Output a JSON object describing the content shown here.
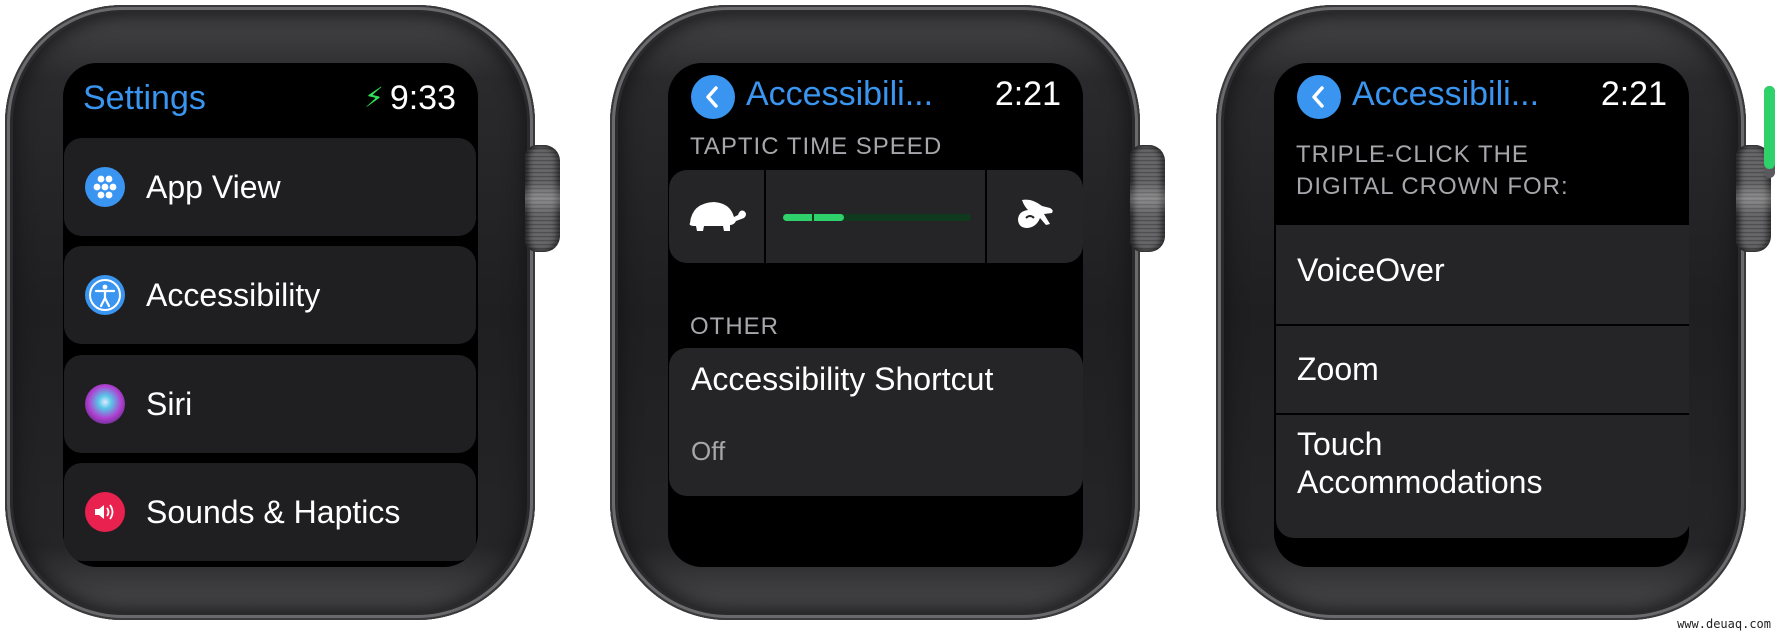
{
  "colors": {
    "accent_blue": "#3a95f0",
    "green": "#2ed16a",
    "card": "#1f1f21",
    "secondary_text": "#a6a6ab"
  },
  "watch1": {
    "title": "Settings",
    "charging_icon": "bolt-icon",
    "time": "9:33",
    "items": [
      {
        "label": "App View",
        "icon": "app-view-grid-icon",
        "icon_color": "#3a95f0"
      },
      {
        "label": "Accessibility",
        "icon": "accessibility-icon",
        "icon_color": "#3a95f0"
      },
      {
        "label": "Siri",
        "icon": "siri-icon",
        "icon_color": "#7a3bd0"
      },
      {
        "label": "Sounds & Haptics",
        "icon": "speaker-icon",
        "icon_color": "#e8214f"
      }
    ]
  },
  "watch2": {
    "back_icon": "chevron-left-icon",
    "title": "Accessibili...",
    "time": "2:21",
    "section1": "TAPTIC TIME SPEED",
    "slider": {
      "min_icon": "turtle-icon",
      "max_icon": "rabbit-icon",
      "segments": 6,
      "filled_segments": 2,
      "value_fraction": 0.333
    },
    "section2": "OTHER",
    "shortcut": {
      "title": "Accessibility Shortcut",
      "value": "Off"
    }
  },
  "watch3": {
    "back_icon": "chevron-left-icon",
    "title": "Accessibili...",
    "time": "2:21",
    "header": "TRIPLE-CLICK THE DIGITAL CROWN FOR:",
    "options": [
      {
        "label": "VoiceOver"
      },
      {
        "label": "Zoom"
      },
      {
        "label": "Touch Accommodations"
      }
    ],
    "scroll_position_fraction": 0.9
  },
  "watermark": "www.deuaq.com"
}
